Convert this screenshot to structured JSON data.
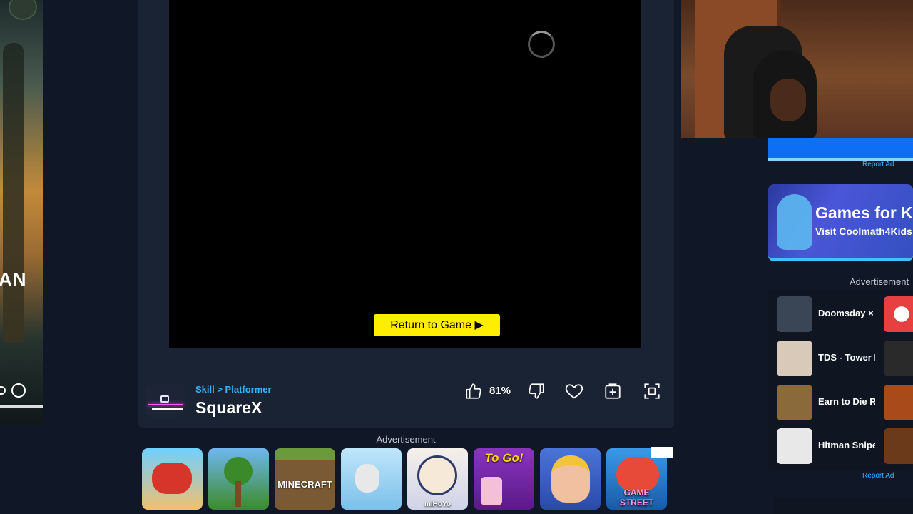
{
  "game": {
    "breadcrumb": "Skill > Platformer",
    "title": "SquareX",
    "return_button": "Return to Game ▶",
    "rating": "81%"
  },
  "actions": [
    {
      "name": "like-icon"
    },
    {
      "name": "dislike-icon"
    },
    {
      "name": "favorite-heart-icon"
    },
    {
      "name": "add-to-collection-icon"
    },
    {
      "name": "fullscreen-icon"
    }
  ],
  "ads": {
    "bottom_label": "Advertisement",
    "side_label": "Advertisement",
    "report_top": "Report Ad",
    "report_bottom": "Report Ad",
    "banner_title": "Games for K",
    "banner_subtitle": "Visit Coolmath4Kids",
    "tiles": [
      {
        "icon": "moto-x3m-icon",
        "color": "#4fb7e8"
      },
      {
        "icon": "terraria-icon",
        "color": "#5aa2e0"
      },
      {
        "icon": "minecraft-icon",
        "color": "#7a5a34",
        "label": "MINECRAFT"
      },
      {
        "icon": "human-fall-flat-icon",
        "color": "#9ed6f5"
      },
      {
        "icon": "genshin-impact-icon",
        "color": "#e8e4ef",
        "label": "miHoYo"
      },
      {
        "icon": "papas-to-go-icon",
        "color": "#7a2aa8",
        "label": "To Go!"
      },
      {
        "icon": "royal-match-icon",
        "color": "#3a5ec8"
      },
      {
        "icon": "candy-crush-icon",
        "color": "#2f86d8",
        "label": "GAME STREET"
      }
    ],
    "side_games": [
      {
        "name": "Doomsday × I",
        "thumb": "#3a4656",
        "thumb2": "#e84040"
      },
      {
        "name": "TDS - Tower I",
        "thumb": "#d9c9b8",
        "thumb2": "#2a2a2a"
      },
      {
        "name": "Earn to Die R",
        "thumb": "#8a6a3a",
        "thumb2": "#a84a1a"
      },
      {
        "name": "Hitman Snipe",
        "thumb": "#e8e8e8",
        "thumb2": "#6a3a1a"
      }
    ]
  },
  "colors": {
    "accent_blue": "#3ab4ff",
    "return_yellow": "#ffee00",
    "panel_bg": "#1a2333",
    "page_bg": "#101828"
  }
}
